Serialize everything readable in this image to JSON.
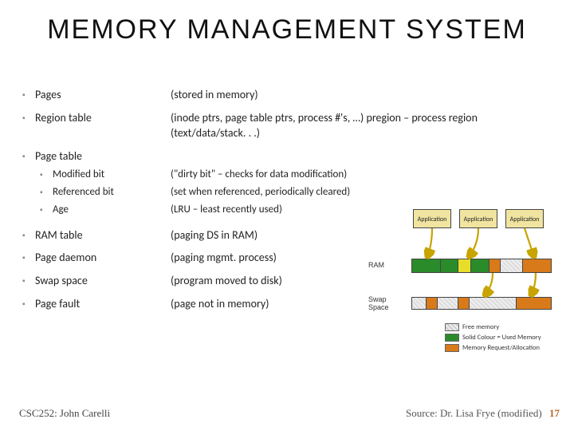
{
  "title": "MEMORY MANAGEMENT SYSTEM",
  "rows": [
    {
      "term": "Pages",
      "desc": "(stored in memory)"
    },
    {
      "term": "Region table",
      "desc": "(inode ptrs, page table ptrs, process #'s, …) pregion – process region (text/data/stack. . .)"
    }
  ],
  "pagetable": {
    "header": "Page table",
    "sub": [
      {
        "term": "Modified bit",
        "desc": "(\"dirty bit\" – checks for data modification)"
      },
      {
        "term": "Referenced bit",
        "desc": "(set when referenced, periodically cleared)"
      },
      {
        "term": "Age",
        "desc": "(LRU – least recently used)"
      }
    ]
  },
  "rows2": [
    {
      "term": "RAM table",
      "desc": "(paging DS in RAM)"
    },
    {
      "term": "Page daemon",
      "desc": "(paging mgmt. process)"
    },
    {
      "term": "Swap space",
      "desc": "(program moved to disk)"
    },
    {
      "term": "Page fault",
      "desc": "(page not in memory)"
    }
  ],
  "diagram": {
    "app_label": "Application",
    "ram_label": "RAM",
    "swap_label": "Swap\nSpace",
    "legend": {
      "free": "Free memory",
      "solid": "Solid Colour = Used Memory",
      "req": "Memory Request/Allocation"
    }
  },
  "footer": {
    "left": "CSC252: John Carelli",
    "right": "Source: Dr. Lisa Frye (modified)",
    "slidenum": "17"
  }
}
